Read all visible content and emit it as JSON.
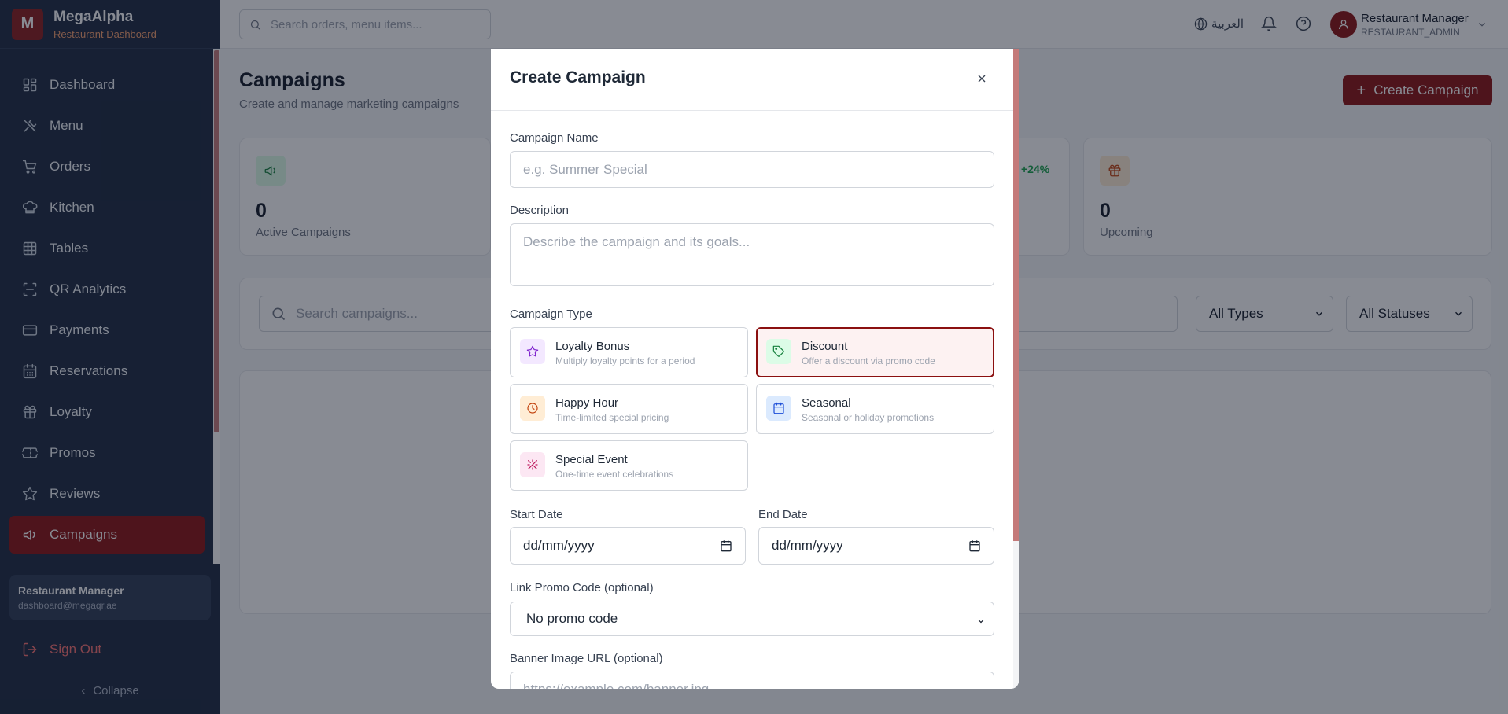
{
  "brand": {
    "logo_letter": "M",
    "name": "MegaAlpha",
    "subtitle": "Restaurant Dashboard"
  },
  "sidebar": {
    "items": [
      {
        "label": "Dashboard",
        "icon": "dashboard-icon"
      },
      {
        "label": "Menu",
        "icon": "utensils-icon"
      },
      {
        "label": "Orders",
        "icon": "cart-icon"
      },
      {
        "label": "Kitchen",
        "icon": "chef-hat-icon"
      },
      {
        "label": "Tables",
        "icon": "table-grid-icon"
      },
      {
        "label": "QR Analytics",
        "icon": "scan-icon"
      },
      {
        "label": "Payments",
        "icon": "credit-card-icon"
      },
      {
        "label": "Reservations",
        "icon": "calendar-icon"
      },
      {
        "label": "Loyalty",
        "icon": "gift-icon"
      },
      {
        "label": "Promos",
        "icon": "ticket-icon"
      },
      {
        "label": "Reviews",
        "icon": "star-icon"
      },
      {
        "label": "Campaigns",
        "icon": "megaphone-icon",
        "active": true
      }
    ],
    "user": {
      "name": "Restaurant Manager",
      "email": "dashboard@megaqr.ae"
    },
    "sign_out": "Sign Out",
    "collapse": "Collapse"
  },
  "topbar": {
    "search_placeholder": "Search orders, menu items...",
    "language": "العربية",
    "user_name": "Restaurant Manager",
    "user_role": "RESTAURANT_ADMIN"
  },
  "page": {
    "title": "Campaigns",
    "subtitle": "Create and manage marketing campaigns",
    "create_button": "Create Campaign",
    "stats": [
      {
        "value": "0",
        "label": "Active Campaigns",
        "icon": "megaphone-icon"
      },
      {
        "value": "0",
        "label": "Upcoming",
        "icon": "gift-icon"
      }
    ],
    "trend": "+24%",
    "search_placeholder": "Search campaigns...",
    "type_filter": "All Types",
    "status_filter": "All Statuses"
  },
  "modal": {
    "title": "Create Campaign",
    "name_label": "Campaign Name",
    "name_placeholder": "e.g. Summer Special",
    "description_label": "Description",
    "description_placeholder": "Describe the campaign and its goals...",
    "type_label": "Campaign Type",
    "types": [
      {
        "title": "Loyalty Bonus",
        "desc": "Multiply loyalty points for a period",
        "icon": "star-icon"
      },
      {
        "title": "Discount",
        "desc": "Offer a discount via promo code",
        "icon": "tag-icon",
        "selected": true
      },
      {
        "title": "Happy Hour",
        "desc": "Time-limited special pricing",
        "icon": "clock-icon"
      },
      {
        "title": "Seasonal",
        "desc": "Seasonal or holiday promotions",
        "icon": "calendar-icon"
      },
      {
        "title": "Special Event",
        "desc": "One-time event celebrations",
        "icon": "sparkles-icon"
      }
    ],
    "start_label": "Start Date",
    "start_value": "dd/mm/yyyy",
    "end_label": "End Date",
    "end_value": "dd/mm/yyyy",
    "promo_label": "Link Promo Code (optional)",
    "promo_value": "No promo code",
    "banner_label": "Banner Image URL (optional)",
    "banner_placeholder": "https://example.com/banner.jpg"
  },
  "colors": {
    "brand": "#8b1010",
    "sidebar_bg": "#1c2840",
    "accent_orange": "#f59e6c",
    "trend_green": "#16a34a"
  }
}
